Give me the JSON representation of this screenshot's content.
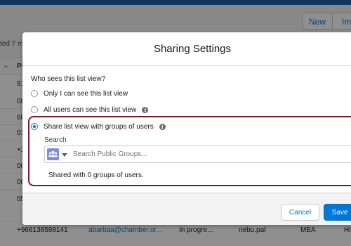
{
  "background": {
    "header_buttons": {
      "new": "New",
      "import": "Imp"
    },
    "updated_text": "ted 7 m",
    "column_header": "Ph",
    "phone_cells": [
      "91",
      "08",
      "60",
      "01",
      "+2",
      "00",
      "00",
      "05"
    ],
    "bottom_row": {
      "phone": "+966138598141",
      "email": "abarbaa@chamber.or...",
      "status": "In progre...",
      "owner": "nebu.pal",
      "region": "MEA",
      "extra": "Hi"
    }
  },
  "modal": {
    "title": "Sharing Settings",
    "question": "Who sees this list view?",
    "options": [
      {
        "label": "Only I can see this list view",
        "checked": false,
        "info": false
      },
      {
        "label": "All users can see this list view",
        "checked": false,
        "info": true
      },
      {
        "label": "Share list view with groups of users",
        "checked": true,
        "info": true
      }
    ],
    "search": {
      "label": "Search",
      "placeholder": "Search Public Groups...",
      "value": "",
      "icon": "group-icon"
    },
    "shared_status": "Shared with 0 groups of users.",
    "buttons": {
      "cancel": "Cancel",
      "save": "Save"
    }
  },
  "colors": {
    "brand_blue": "#0176d3",
    "highlight_border": "#7b1c27",
    "group_icon_bg": "#7f8de1"
  }
}
